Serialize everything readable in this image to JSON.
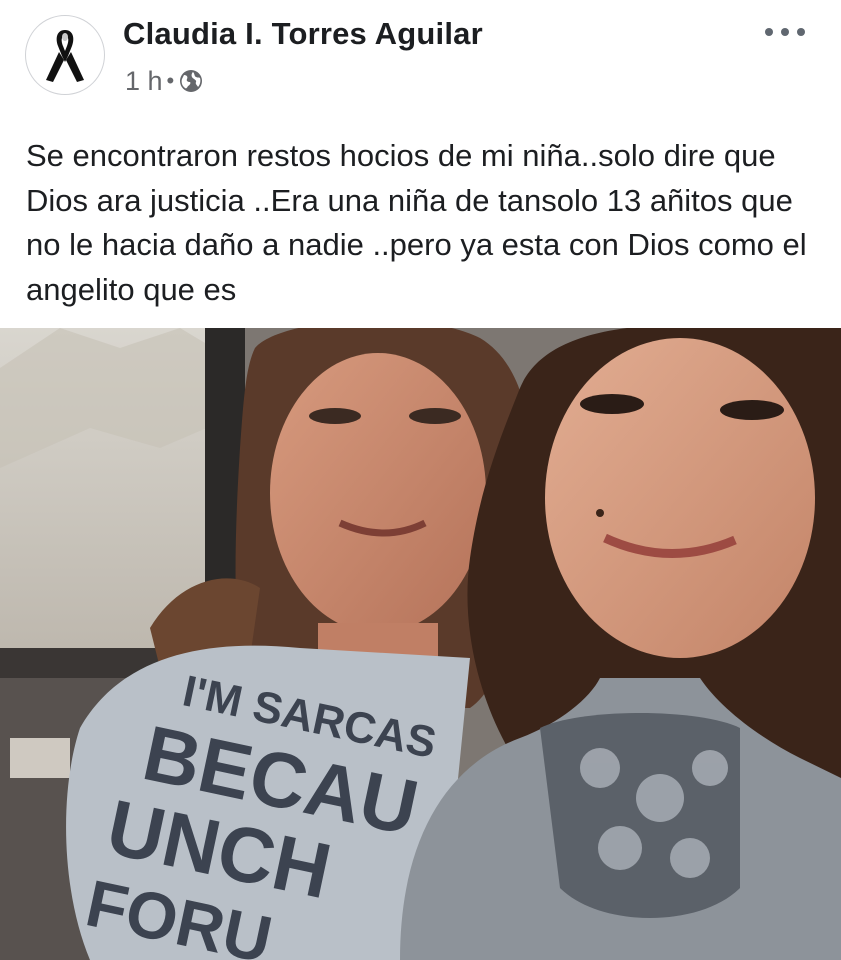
{
  "post": {
    "author": "Claudia I. Torres Aguilar",
    "timestamp": "1 h",
    "separator": "•",
    "audience_icon": "globe-icon",
    "avatar_icon": "black-ribbon-icon",
    "more_icon": "more-options-icon",
    "text": "Se encontraron restos hocios de mi niña..solo dire que Dios ara justicia ..Era una niña de tansolo 13 añitos que no le hacia daño a nadie ..pero ya esta con Dios como el angelito que es"
  },
  "photo": {
    "shirt_text": [
      "I'M SARCAS",
      "BECAU",
      "UNCH",
      "FORU"
    ]
  },
  "colors": {
    "name_text": "#1c1e21",
    "meta_text": "#65676b",
    "icon_gray": "#606770",
    "background": "#ffffff"
  }
}
